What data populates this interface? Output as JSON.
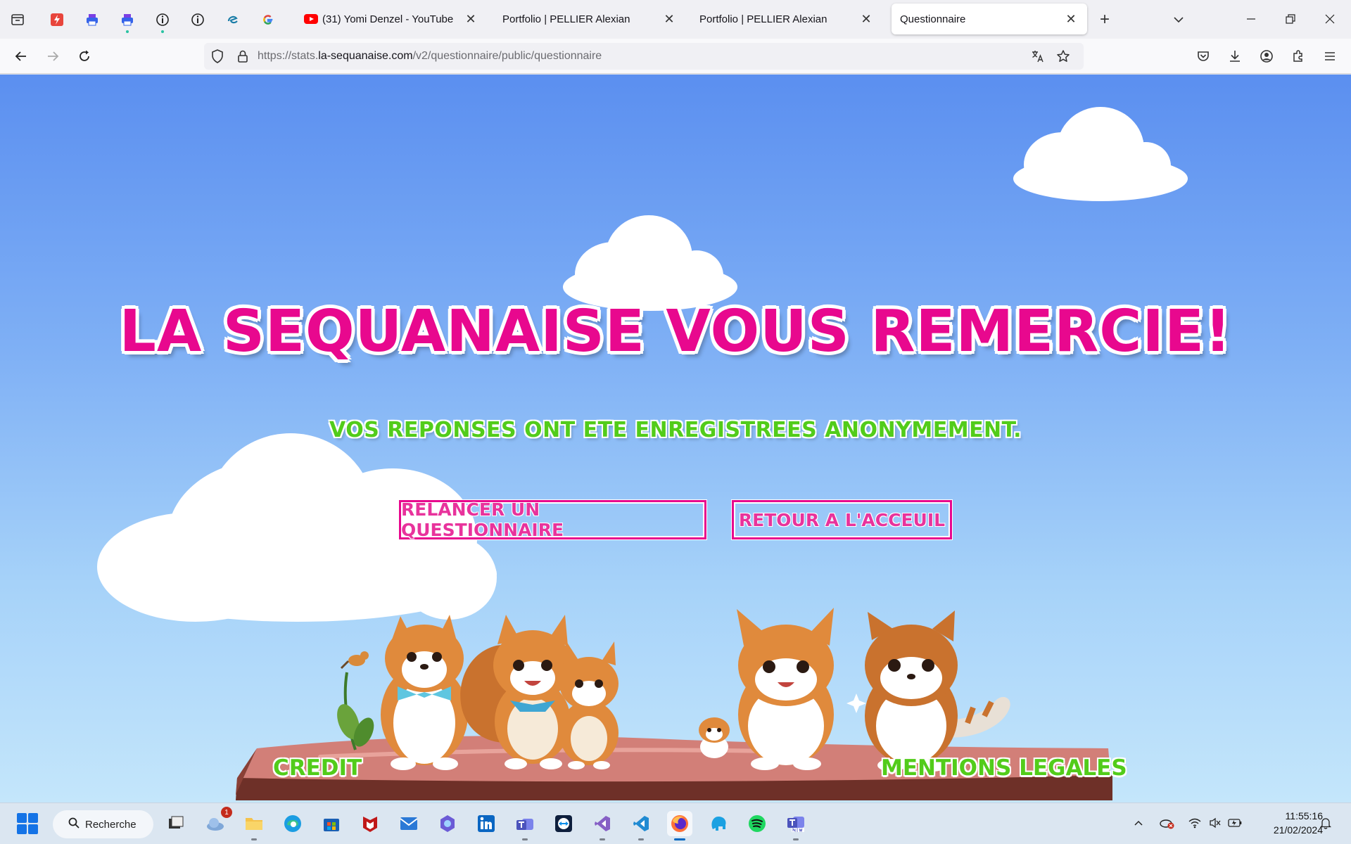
{
  "browser": {
    "tabs": [
      {
        "title": "(31) Yomi Denzel - YouTube"
      },
      {
        "title": "Portfolio | PELLIER Alexian"
      },
      {
        "title": "Portfolio | PELLIER Alexian"
      },
      {
        "title": "Questionnaire",
        "active": true
      }
    ],
    "url": {
      "prefix": "https://stats.",
      "domain": "la-sequanaise.com",
      "path": "/v2/questionnaire/public/questionnaire"
    }
  },
  "page": {
    "title": "LA SEQUANAISE VOUS REMERCIE!",
    "subtitle": "VOS REPONSES ONT ETE ENREGISTREES ANONYMEMENT.",
    "buttons": {
      "relaunch": "RELANCER UN QUESTIONNAIRE",
      "home": "RETOUR A L'ACCEUIL"
    },
    "footer": {
      "credit": "CREDIT",
      "legal": "MENTIONS LEGALES"
    },
    "colors": {
      "title": "#e8088e",
      "accent_green": "#52cc1a",
      "sky_top": "#5b8ff0",
      "sky_bottom": "#c4e6fb"
    }
  },
  "taskbar": {
    "search_label": "Recherche",
    "weather_badge": "1",
    "time": "11:55:16",
    "date": "21/02/2024"
  }
}
